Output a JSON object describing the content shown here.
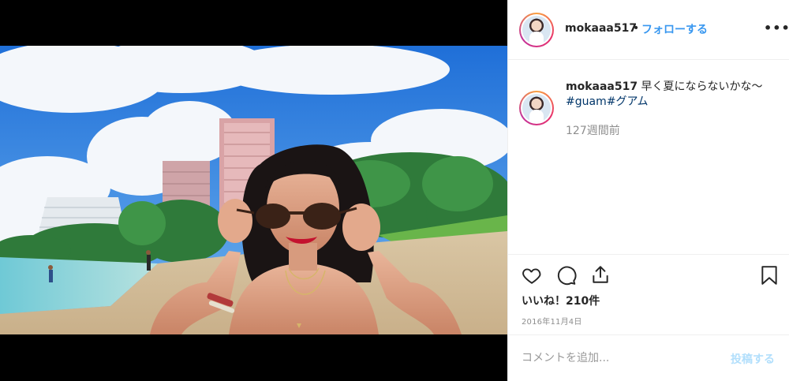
{
  "post": {
    "username": "mokaaa517",
    "separator": "•",
    "follow_label": "フォローする",
    "more_label": "•••",
    "caption": {
      "username": "mokaaa517",
      "text": "早く夏にならないかな〜",
      "hashtags": [
        "#guam",
        "#グアム"
      ]
    },
    "time_ago": "127週間前",
    "likes_label": "いいね！210件",
    "date_label": "2016年11月4日",
    "comment_placeholder": "コメントを追加...",
    "post_button_label": "投稿する"
  },
  "icons": {
    "like": "heart-icon",
    "comment": "comment-icon",
    "share": "share-icon",
    "save": "bookmark-icon",
    "more": "more-icon"
  },
  "colors": {
    "link_blue": "#3897f0",
    "hashtag": "#003569",
    "muted": "#8e8e8e",
    "post_button_disabled": "#b2dffc"
  }
}
